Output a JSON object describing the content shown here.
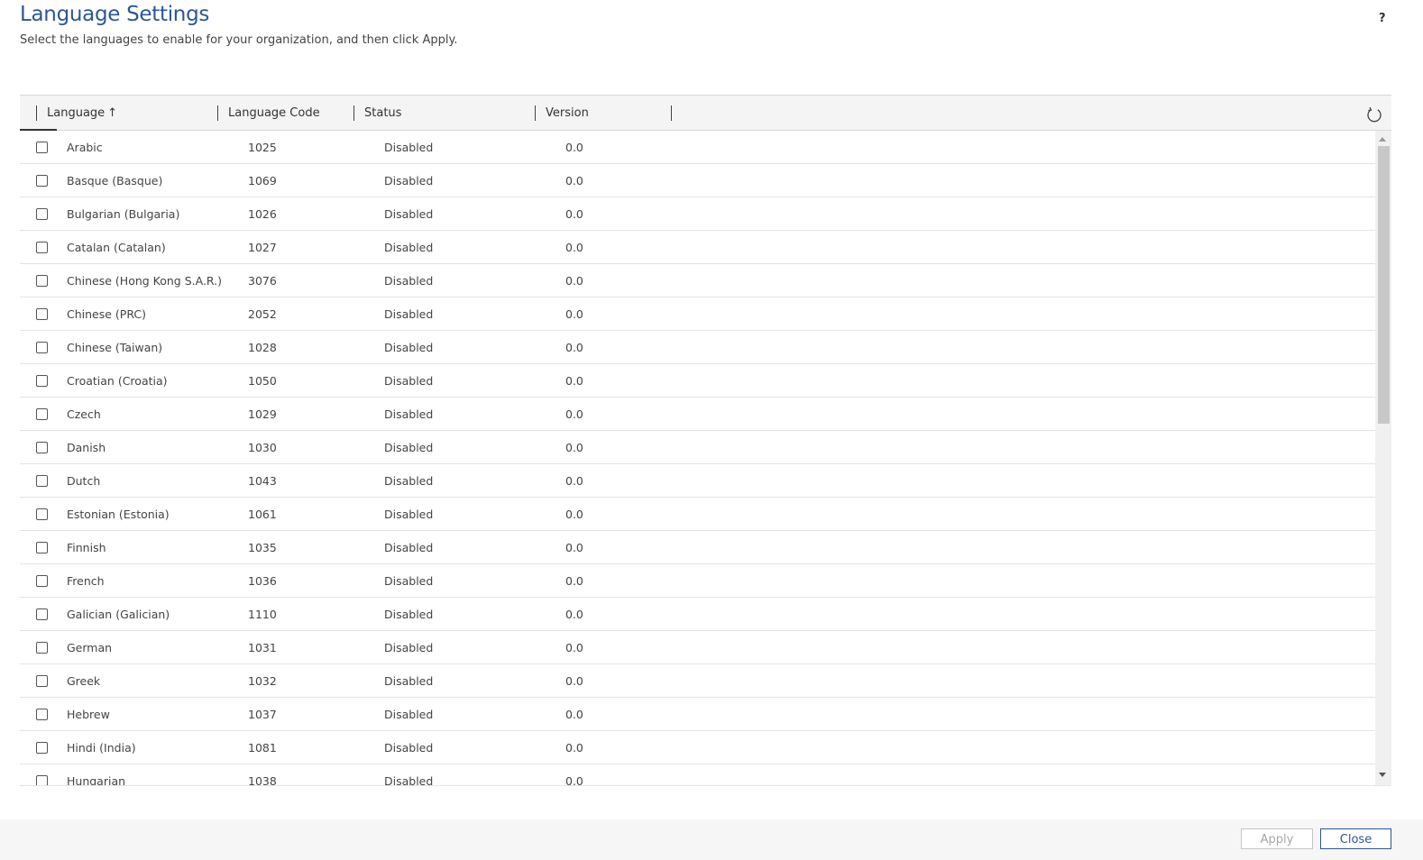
{
  "page": {
    "title": "Language Settings",
    "subtitle": "Select the languages to enable for your organization, and then click Apply.",
    "help_label": "?"
  },
  "columns": {
    "language": "Language",
    "language_sort_icon": "arrow-up-icon",
    "language_sort_glyph": "↑",
    "code": "Language Code",
    "status": "Status",
    "version": "Version",
    "refresh_icon": "refresh-icon"
  },
  "rows": [
    {
      "language": "Arabic",
      "code": "1025",
      "status": "Disabled",
      "version": "0.0"
    },
    {
      "language": "Basque (Basque)",
      "code": "1069",
      "status": "Disabled",
      "version": "0.0"
    },
    {
      "language": "Bulgarian (Bulgaria)",
      "code": "1026",
      "status": "Disabled",
      "version": "0.0"
    },
    {
      "language": "Catalan (Catalan)",
      "code": "1027",
      "status": "Disabled",
      "version": "0.0"
    },
    {
      "language": "Chinese (Hong Kong S.A.R.)",
      "code": "3076",
      "status": "Disabled",
      "version": "0.0"
    },
    {
      "language": "Chinese (PRC)",
      "code": "2052",
      "status": "Disabled",
      "version": "0.0"
    },
    {
      "language": "Chinese (Taiwan)",
      "code": "1028",
      "status": "Disabled",
      "version": "0.0"
    },
    {
      "language": "Croatian (Croatia)",
      "code": "1050",
      "status": "Disabled",
      "version": "0.0"
    },
    {
      "language": "Czech",
      "code": "1029",
      "status": "Disabled",
      "version": "0.0"
    },
    {
      "language": "Danish",
      "code": "1030",
      "status": "Disabled",
      "version": "0.0"
    },
    {
      "language": "Dutch",
      "code": "1043",
      "status": "Disabled",
      "version": "0.0"
    },
    {
      "language": "Estonian (Estonia)",
      "code": "1061",
      "status": "Disabled",
      "version": "0.0"
    },
    {
      "language": "Finnish",
      "code": "1035",
      "status": "Disabled",
      "version": "0.0"
    },
    {
      "language": "French",
      "code": "1036",
      "status": "Disabled",
      "version": "0.0"
    },
    {
      "language": "Galician (Galician)",
      "code": "1110",
      "status": "Disabled",
      "version": "0.0"
    },
    {
      "language": "German",
      "code": "1031",
      "status": "Disabled",
      "version": "0.0"
    },
    {
      "language": "Greek",
      "code": "1032",
      "status": "Disabled",
      "version": "0.0"
    },
    {
      "language": "Hebrew",
      "code": "1037",
      "status": "Disabled",
      "version": "0.0"
    },
    {
      "language": "Hindi (India)",
      "code": "1081",
      "status": "Disabled",
      "version": "0.0"
    },
    {
      "language": "Hungarian",
      "code": "1038",
      "status": "Disabled",
      "version": "0.0"
    }
  ],
  "footer": {
    "apply_label": "Apply",
    "close_label": "Close"
  },
  "colors": {
    "accent": "#2b5797",
    "header_bg": "#f4f4f4",
    "footer_bg": "#f6f6f6",
    "disabled_text": "#a6a6a6"
  }
}
